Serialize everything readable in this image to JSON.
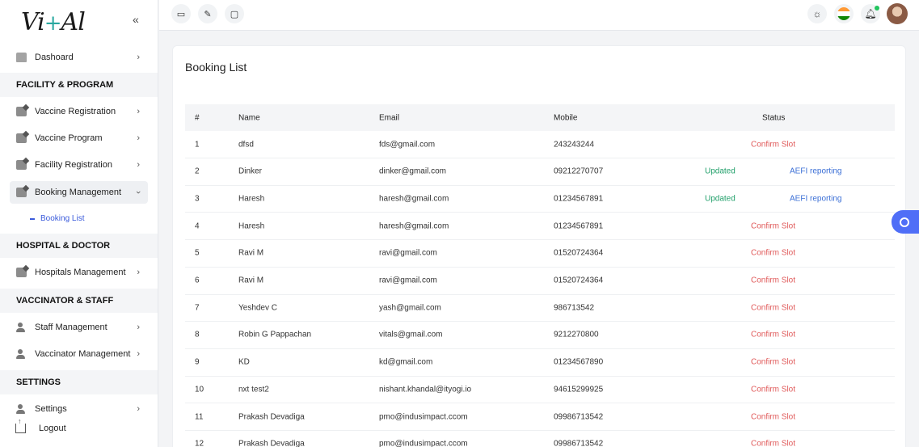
{
  "logo": {
    "text_a": "Vi",
    "plus": "+",
    "text_b": "Al"
  },
  "sidebar": {
    "collapse_icon": "double-chevron-left-icon",
    "dashboard": "Dashoard",
    "sections": {
      "facility": "FACILITY & PROGRAM",
      "hospital": "HOSPITAL & DOCTOR",
      "vaccinator": "VACCINATOR & STAFF",
      "settings": "SETTINGS"
    },
    "items": {
      "vaccine_registration": "Vaccine Registration",
      "vaccine_program": "Vaccine Program",
      "facility_registration": "Facility Registration",
      "booking_management": "Booking Management",
      "booking_list": "Booking List",
      "hospitals_management": "Hospitals Management",
      "staff_management": "Staff Management",
      "vaccinator_management": "Vaccinator Management",
      "settings": "Settings",
      "logout": "Logout"
    }
  },
  "topbar": {
    "icons": [
      "calendar-icon",
      "edit-icon",
      "chat-icon"
    ],
    "right_icons": [
      "sun-icon",
      "india-flag-icon",
      "bell-icon",
      "user-avatar"
    ]
  },
  "booking": {
    "title": "Booking List",
    "columns": {
      "num": "#",
      "name": "Name",
      "email": "Email",
      "mobile": "Mobile",
      "status": "Status"
    },
    "rows": [
      {
        "num": "1",
        "name": "dfsd",
        "email": "fds@gmail.com",
        "mobile": "243243244",
        "status": "confirm",
        "confirm": "Confirm Slot"
      },
      {
        "num": "2",
        "name": "Dinker",
        "email": "dinker@gmail.com",
        "mobile": "09212270707",
        "status": "updated",
        "updated": "Updated",
        "aefi": "AEFI reporting"
      },
      {
        "num": "3",
        "name": "Haresh",
        "email": "haresh@gmail.com",
        "mobile": "01234567891",
        "status": "updated",
        "updated": "Updated",
        "aefi": "AEFI reporting"
      },
      {
        "num": "4",
        "name": "Haresh",
        "email": "haresh@gmail.com",
        "mobile": "01234567891",
        "status": "confirm",
        "confirm": "Confirm Slot"
      },
      {
        "num": "5",
        "name": "Ravi M",
        "email": "ravi@gmail.com",
        "mobile": "01520724364",
        "status": "confirm",
        "confirm": "Confirm Slot"
      },
      {
        "num": "6",
        "name": "Ravi M",
        "email": "ravi@gmail.com",
        "mobile": "01520724364",
        "status": "confirm",
        "confirm": "Confirm Slot"
      },
      {
        "num": "7",
        "name": "Yeshdev C",
        "email": "yash@gmail.com",
        "mobile": "986713542",
        "status": "confirm",
        "confirm": "Confirm Slot"
      },
      {
        "num": "8",
        "name": "Robin G Pappachan",
        "email": "vitals@gmail.com",
        "mobile": "9212270800",
        "status": "confirm",
        "confirm": "Confirm Slot"
      },
      {
        "num": "9",
        "name": "KD",
        "email": "kd@gmail.com",
        "mobile": "01234567890",
        "status": "confirm",
        "confirm": "Confirm Slot"
      },
      {
        "num": "10",
        "name": "nxt test2",
        "email": "nishant.khandal@ityogi.io",
        "mobile": "94615299925",
        "status": "confirm",
        "confirm": "Confirm Slot"
      },
      {
        "num": "11",
        "name": "Prakash Devadiga",
        "email": "pmo@indusimpact.ccom",
        "mobile": "09986713542",
        "status": "confirm",
        "confirm": "Confirm Slot"
      },
      {
        "num": "12",
        "name": "Prakash Devadiga",
        "email": "pmo@indusimpact.ccom",
        "mobile": "09986713542",
        "status": "confirm",
        "confirm": "Confirm Slot"
      }
    ]
  },
  "colors": {
    "accent": "#3b5bdb",
    "confirm": "#e05a5a",
    "updated": "#22a06b",
    "aefi": "#3b6fd6"
  }
}
